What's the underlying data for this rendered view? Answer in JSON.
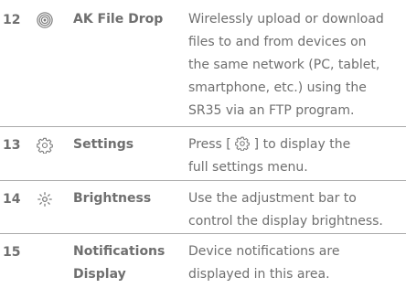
{
  "rows": [
    {
      "number": "12",
      "icon": "wireless-signal-icon",
      "label": "AK File Drop",
      "lines": [
        "Wirelessly upload or download",
        "files to and from devices on",
        "the same network (PC, tablet,",
        "smartphone, etc.) using the",
        "SR35 via an FTP program."
      ]
    },
    {
      "number": "13",
      "icon": "gear-icon",
      "label": "Settings",
      "desc_prefix": "Press [",
      "desc_inline_icon": "gear-icon",
      "desc_suffix": "] to display the",
      "desc_line2": "full settings menu."
    },
    {
      "number": "14",
      "icon": "brightness-icon",
      "label": "Brightness",
      "lines": [
        "Use the adjustment bar to",
        "control the display brightness."
      ]
    },
    {
      "number": "15",
      "icon": "",
      "label_lines": [
        "Notifications",
        "Display"
      ],
      "lines": [
        "Device notifications are",
        "displayed in this area."
      ]
    }
  ],
  "colors": {
    "text": "#6f6f6f",
    "divider": "#aaaaaa",
    "background": "#ffffff"
  }
}
